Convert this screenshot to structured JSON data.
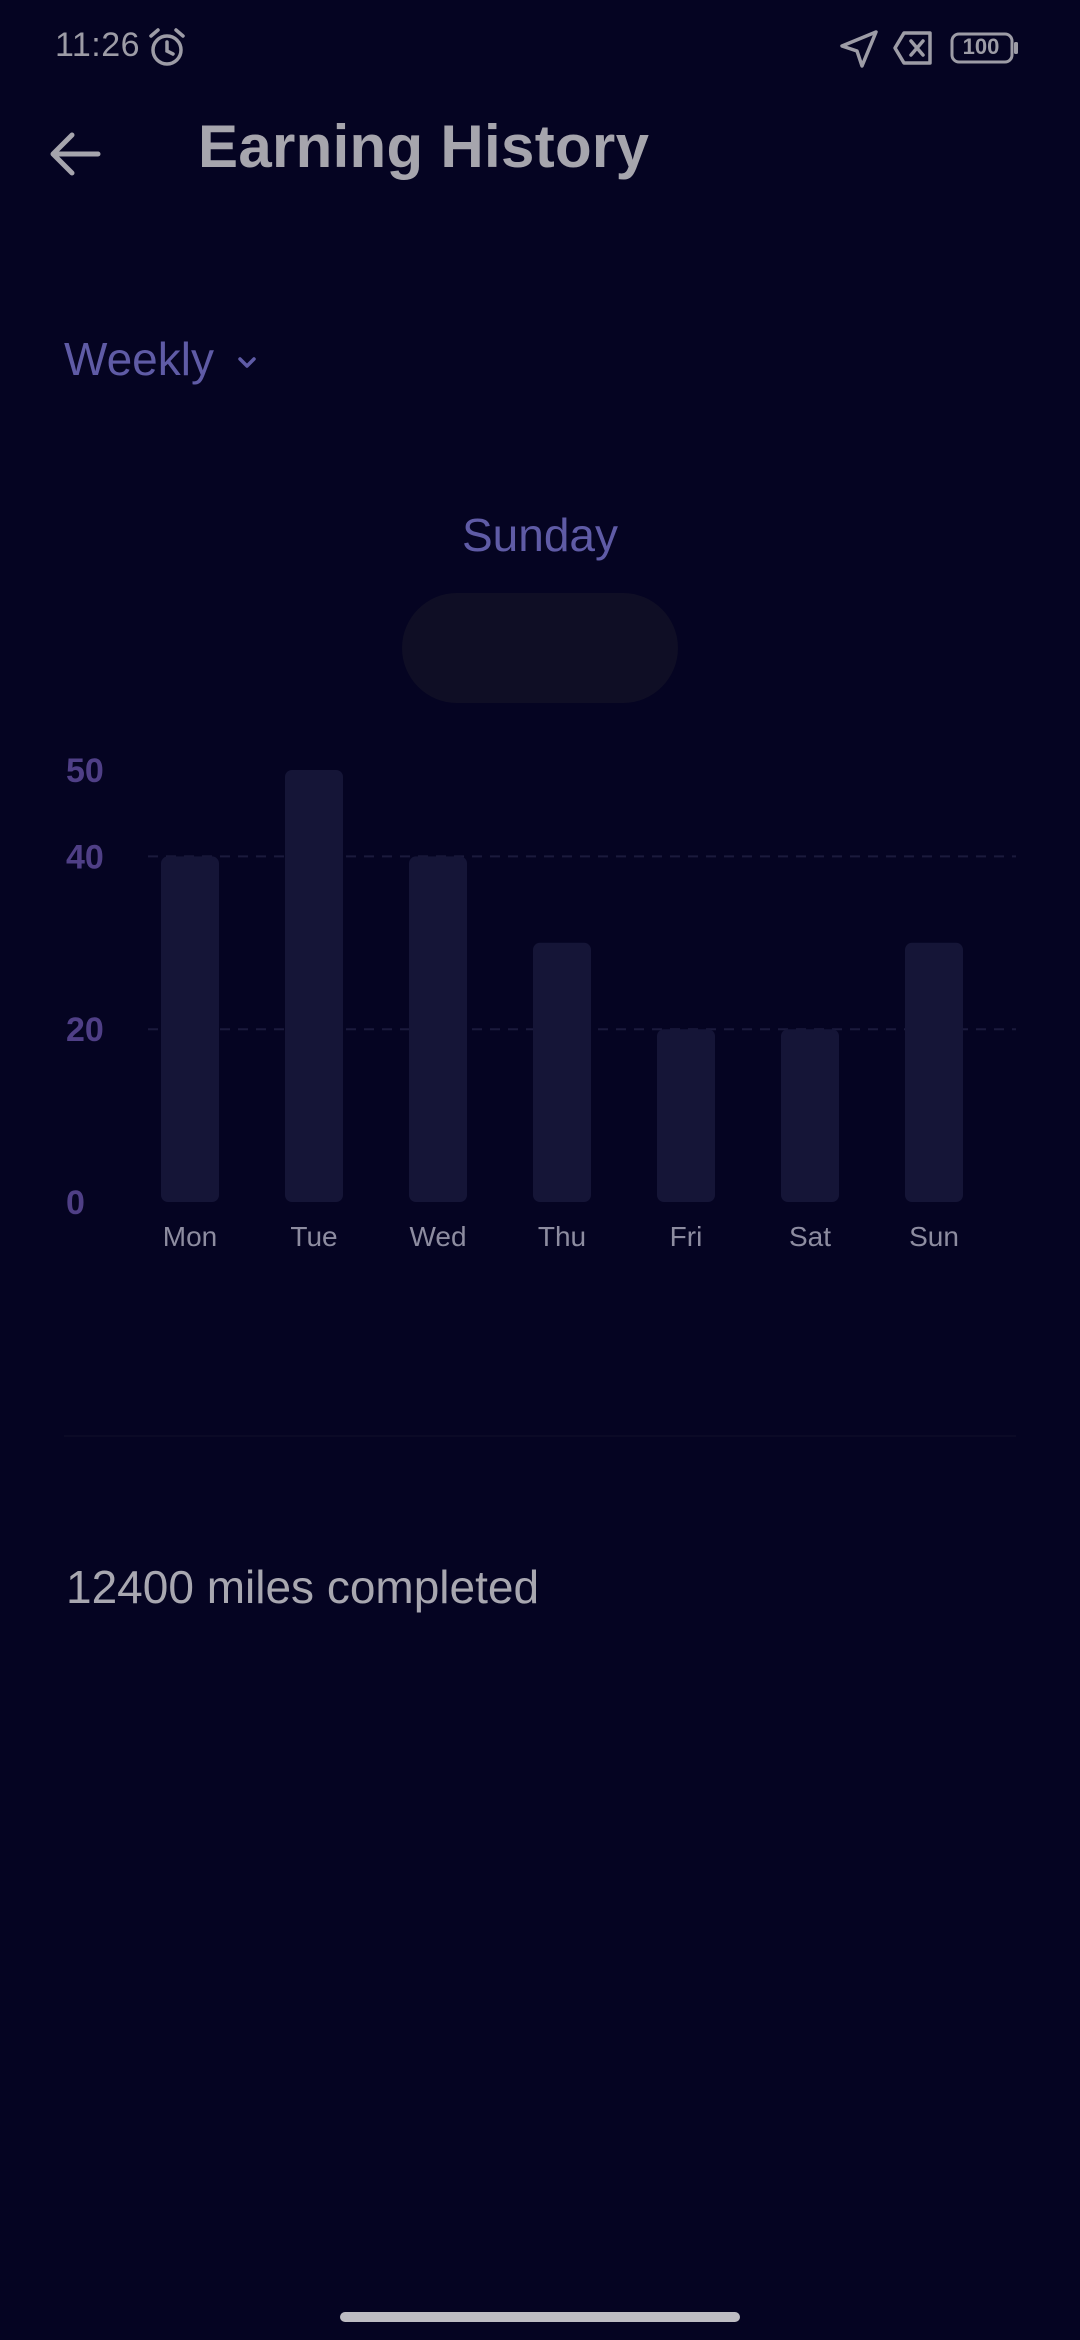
{
  "status_bar": {
    "time": "11:26",
    "battery": "100",
    "icons": [
      "alarm-icon",
      "location-arrow-icon",
      "no-sim-icon",
      "battery-icon"
    ]
  },
  "header": {
    "back_icon": "arrow-left-icon",
    "title": "Earning History"
  },
  "period": {
    "selected": "Weekly",
    "chevron_icon": "chevron-down-icon"
  },
  "selected_day": "Sunday",
  "chart_data": {
    "type": "bar",
    "categories": [
      "Mon",
      "Tue",
      "Wed",
      "Thu",
      "Fri",
      "Sat",
      "Sun"
    ],
    "values": [
      40,
      50,
      40,
      30,
      20,
      20,
      30
    ],
    "y_ticks": [
      "0",
      "20",
      "40",
      "50"
    ],
    "ylim": [
      0,
      50
    ],
    "gridlines_at": [
      20,
      40
    ],
    "grid": "dashed horizontal",
    "bar_color": "#151537",
    "tick_color": "#4f3f86"
  },
  "summary": {
    "miles_text": "12400 miles completed"
  },
  "colors": {
    "background": "#050422",
    "accent": "#5f5ba6",
    "title": "#a6a5ad"
  }
}
